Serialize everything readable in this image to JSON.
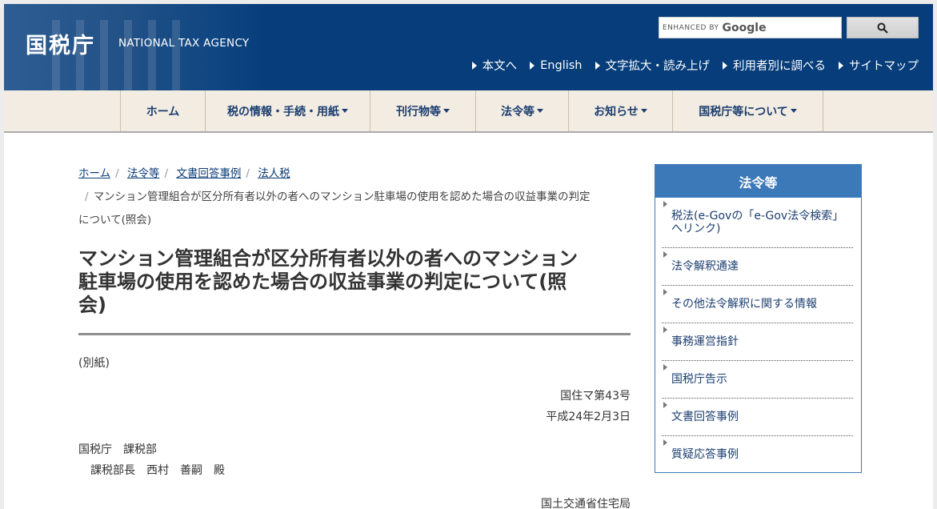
{
  "header": {
    "logo": "国税庁",
    "logo_en": "NATIONAL TAX AGENCY",
    "search": {
      "enhanced_by": "ENHANCED BY",
      "google": "Google"
    },
    "util_links": [
      "本文へ",
      "English",
      "文字拡大・読み上げ",
      "利用者別に調べる",
      "サイトマップ"
    ]
  },
  "nav": {
    "items": [
      {
        "label": "ホーム",
        "dropdown": false
      },
      {
        "label": "税の情報・手続・用紙",
        "dropdown": true
      },
      {
        "label": "刊行物等",
        "dropdown": true
      },
      {
        "label": "法令等",
        "dropdown": true
      },
      {
        "label": "お知らせ",
        "dropdown": true
      },
      {
        "label": "国税庁等について",
        "dropdown": true
      }
    ]
  },
  "breadcrumb": {
    "links": [
      "ホーム",
      "法令等",
      "文書回答事例",
      "法人税"
    ],
    "current_line1": "マンション管理組合が区分所有者以外の者へのマンション駐車場の使用を認めた場合の収益事業の判定",
    "current_line2": "について(照会)"
  },
  "main": {
    "title_line1": "マンション管理組合が区分所有者以外の者へのマンション",
    "title_line2": "駐車場の使用を認めた場合の収益事業の判定について(照",
    "title_line3": "会)",
    "attachment": "(別紙)",
    "doc_number": "国住マ第43号",
    "doc_date": "平成24年2月3日",
    "recipient_org": "国税庁　課税部",
    "recipient_name": "課税部長　西村　善嗣　殿",
    "sender": "国土交通省住宅局"
  },
  "sidebar": {
    "title": "法令等",
    "items": [
      {
        "line1": "税法(e-Govの「e-Gov法令検索」",
        "line2": "へリンク)"
      },
      {
        "line1": "法令解釈通達"
      },
      {
        "line1": "その他法令解釈に関する情報"
      },
      {
        "line1": "事務運営指針"
      },
      {
        "line1": "国税庁告示"
      },
      {
        "line1": "文書回答事例"
      },
      {
        "line1": "質疑応答事例"
      }
    ]
  },
  "colors": {
    "header_bg": "#063d7a",
    "nav_bg": "#f3ece2",
    "sidebar_accent": "#3c79b8",
    "link": "#0b3c78"
  }
}
